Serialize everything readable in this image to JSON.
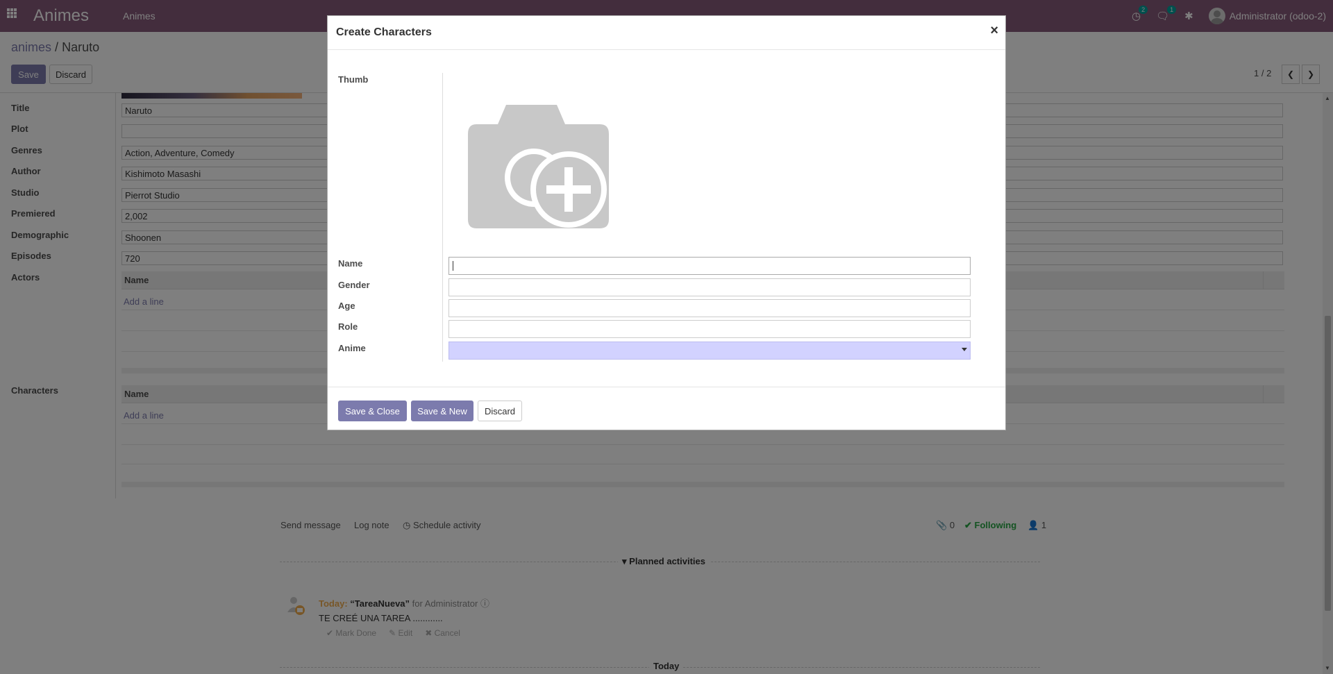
{
  "navbar": {
    "brand": "Animes",
    "menu_item": "Animes",
    "activity_badge": "2",
    "messages_badge": "1",
    "user_name": "Administrator (odoo-2)"
  },
  "control_panel": {
    "breadcrumb_parent": "animes",
    "breadcrumb_separator": "/",
    "breadcrumb_current": "Naruto",
    "save_label": "Save",
    "discard_label": "Discard",
    "pager": "1 / 2"
  },
  "form": {
    "fields": [
      {
        "label": "Title",
        "value": "Naruto"
      },
      {
        "label": "Plot",
        "value": ""
      },
      {
        "label": "Genres",
        "value": "Action, Adventure, Comedy"
      },
      {
        "label": "Author",
        "value": "Kishimoto Masashi"
      },
      {
        "label": "Studio",
        "value": "Pierrot Studio"
      },
      {
        "label": "Premiered",
        "value": "2,002"
      },
      {
        "label": "Demographic",
        "value": "Shoonen"
      },
      {
        "label": "Episodes",
        "value": "720"
      }
    ],
    "actors_label": "Actors",
    "actors_column": "Name",
    "actors_add_line": "Add a line",
    "characters_label": "Characters",
    "characters_column": "Name",
    "characters_add_line": "Add a line"
  },
  "chatter": {
    "send_message": "Send message",
    "log_note": "Log note",
    "schedule_activity": "Schedule activity",
    "attachments_count": "0",
    "following": "Following",
    "followers_count": "1",
    "planned_activities": "Planned activities",
    "activity": {
      "when": "Today:",
      "name": "“TareaNueva”",
      "assignee": "for Administrator",
      "note": "TE CREÉ UNA TAREA ............",
      "mark_done": "Mark Done",
      "edit": "Edit",
      "cancel": "Cancel"
    },
    "date_separator": "Today"
  },
  "modal": {
    "title": "Create Characters",
    "close_symbol": "×",
    "labels": {
      "thumb": "Thumb",
      "name": "Name",
      "gender": "Gender",
      "age": "Age",
      "role": "Role",
      "anime": "Anime"
    },
    "values": {
      "name": "",
      "gender": "",
      "age": "",
      "role": "",
      "anime": ""
    },
    "footer": {
      "save_close": "Save & Close",
      "save_new": "Save & New",
      "discard": "Discard"
    }
  },
  "colors": {
    "navbar": "#875a7b",
    "primary": "#7c7bad",
    "following": "#28a745",
    "today": "#f0ad4e",
    "selection_field": "#d2d2ff"
  }
}
